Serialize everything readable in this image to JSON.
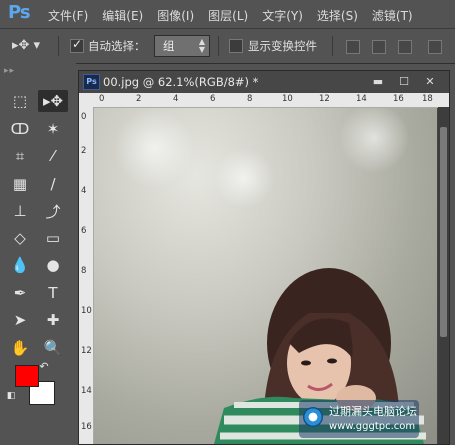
{
  "app": {
    "logo": "Ps"
  },
  "menu": [
    "文件(F)",
    "编辑(E)",
    "图像(I)",
    "图层(L)",
    "文字(Y)",
    "选择(S)",
    "滤镜(T)"
  ],
  "options": {
    "auto_select_label": "自动选择：",
    "auto_select_value": "组",
    "show_transform_label": "显示变换控件"
  },
  "document": {
    "title": "00.jpg @ 62.1%(RGB/8#) *",
    "badge": "Ps",
    "ruler_top": [
      "0",
      "2",
      "4",
      "6",
      "8",
      "10",
      "12",
      "14",
      "16",
      "18"
    ],
    "ruler_left": [
      "0",
      "2",
      "4",
      "6",
      "8",
      "10",
      "12",
      "14",
      "16"
    ]
  },
  "colors": {
    "foreground": "#ff0000",
    "background": "#ffffff"
  },
  "watermark": {
    "line1": "过期漏头电脑论坛",
    "line2": "www.gggtpc.com"
  }
}
